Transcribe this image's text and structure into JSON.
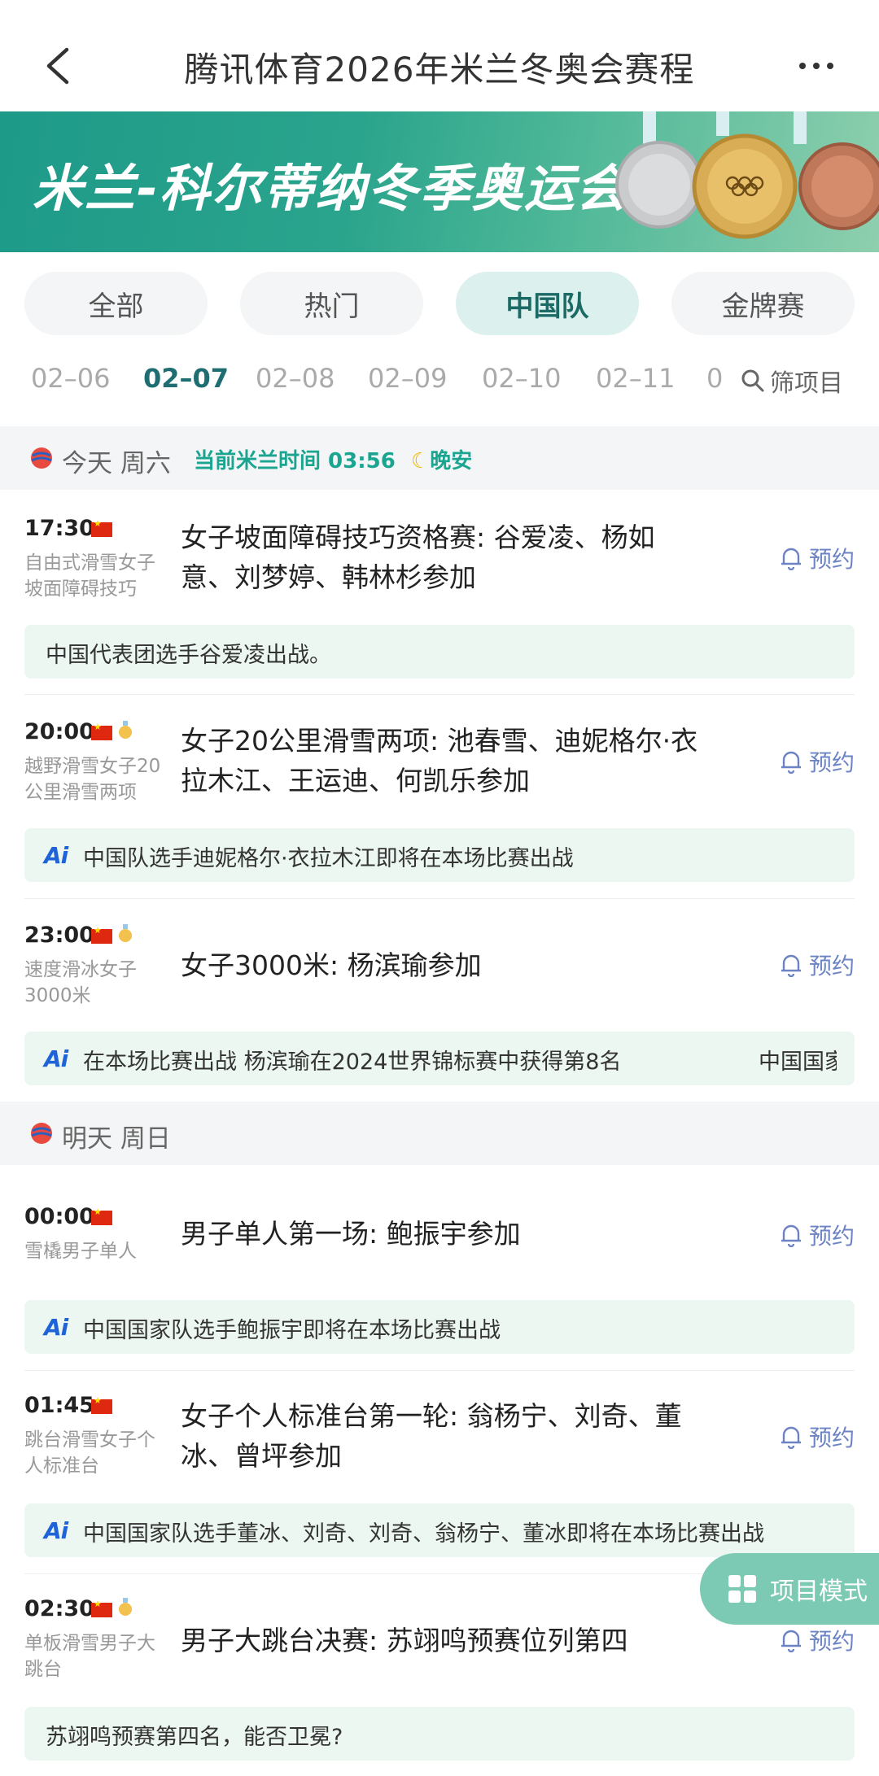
{
  "header": {
    "title": "腾讯体育2026年米兰冬奥会赛程"
  },
  "banner": {
    "text": "米兰-科尔蒂纳冬季奥运会"
  },
  "categories": [
    {
      "label": "全部"
    },
    {
      "label": "热门"
    },
    {
      "label": "中国队",
      "active": true
    },
    {
      "label": "金牌赛"
    }
  ],
  "dates": [
    "02–06",
    "02–07",
    "02–08",
    "02–09",
    "02–10",
    "02–11",
    "0"
  ],
  "active_date": "02–07",
  "filter_label": "筛项目",
  "today": {
    "label": "今天 周六",
    "milan_time": "当前米兰时间 03:56",
    "greeting": "晚安"
  },
  "tomorrow": {
    "label": "明天 周日"
  },
  "reserve_label": "预约",
  "events": [
    {
      "time": "17:30",
      "sport": "自由式滑雪女子坡面障碍技巧",
      "title": "女子坡面障碍技巧资格赛: 谷爱凌、杨如意、刘梦婷、韩林杉参加",
      "medal": false,
      "note": "中国代表团选手谷爱凌出战。",
      "note_ai": false
    },
    {
      "time": "20:00",
      "sport": "越野滑雪女子20公里滑雪两项",
      "title": "女子20公里滑雪两项: 池春雪、迪妮格尔·衣拉木江、王运迪、何凯乐参加",
      "medal": true,
      "note": "中国队选手迪妮格尔·衣拉木江即将在本场比赛出战",
      "note_ai": true
    },
    {
      "time": "23:00",
      "sport": "速度滑冰女子3000米",
      "title": "女子3000米: 杨滨瑜参加",
      "medal": true,
      "note": "在本场比赛出战 杨滨瑜在2024世界锦标赛中获得第8名",
      "note_extra": "中国国家",
      "note_ai": true
    },
    {
      "time": "00:00",
      "sport": "雪橇男子单人",
      "title": "男子单人第一场: 鲍振宇参加",
      "medal": false,
      "note": "中国国家队选手鲍振宇即将在本场比赛出战",
      "note_ai": true
    },
    {
      "time": "01:45",
      "sport": "跳台滑雪女子个人标准台",
      "title": "女子个人标准台第一轮: 翁杨宁、刘奇、董冰、曾坪参加",
      "medal": false,
      "note": "中国国家队选手董冰、刘奇、刘奇、翁杨宁、董冰即将在本场比赛出战",
      "note_ai": true
    },
    {
      "time": "02:30",
      "sport": "单板滑雪男子大跳台",
      "title": "男子大跳台决赛: 苏翊鸣预赛位列第四",
      "medal": true,
      "note": "苏翊鸣预赛第四名，能否卫冕?",
      "note_ai": false
    }
  ],
  "ai_badge": "Ai",
  "fab_label": "项目模式"
}
